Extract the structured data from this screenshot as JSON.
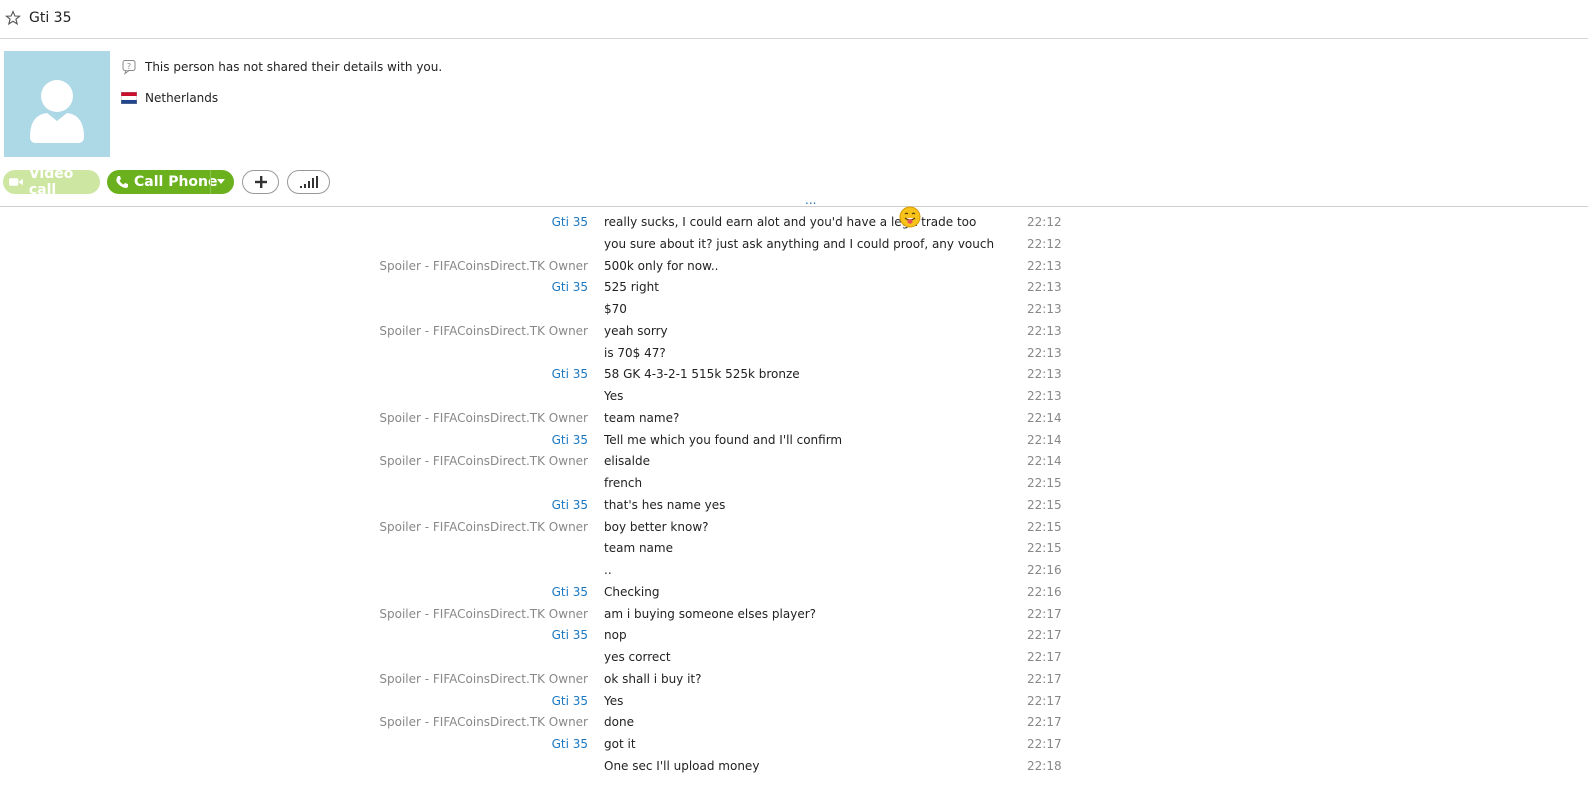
{
  "header": {
    "title": "Gti 35"
  },
  "profile": {
    "privacy_text": "This person has not shared their details with you.",
    "country": "Netherlands"
  },
  "actions": {
    "video_label": "Video call",
    "call_label": "Call Phone"
  },
  "more_messages": "...",
  "colors": {
    "accent_blue": "#1a78c2",
    "call_green": "#6ab11d",
    "avatar_bg": "#add8e6"
  },
  "messages": [
    {
      "sender": "Gti 35",
      "text": "really sucks, I could earn alot and you'd have a legit trade too",
      "time": "22:12"
    },
    {
      "sender": "",
      "text": "you sure about it? just ask anything and I could proof, any vouch",
      "time": "22:12"
    },
    {
      "sender": "Spoiler - FIFACoinsDirect.TK Owner",
      "text": "500k only for now..",
      "time": "22:13"
    },
    {
      "sender": "Gti 35",
      "text": "525 right",
      "time": "22:13"
    },
    {
      "sender": "",
      "text": "$70",
      "time": "22:13"
    },
    {
      "sender": "Spoiler - FIFACoinsDirect.TK Owner",
      "text": "yeah sorry",
      "time": "22:13"
    },
    {
      "sender": "",
      "text": "is 70$ 47?",
      "time": "22:13"
    },
    {
      "sender": "Gti 35",
      "text": "58 GK 4-3-2-1 515k 525k bronze",
      "time": "22:13"
    },
    {
      "sender": "",
      "text": "Yes",
      "time": "22:13"
    },
    {
      "sender": "Spoiler - FIFACoinsDirect.TK Owner",
      "text": "team name?",
      "time": "22:14"
    },
    {
      "sender": "Gti 35",
      "text": "Tell me which you found and I'll confirm",
      "time": "22:14"
    },
    {
      "sender": "Spoiler - FIFACoinsDirect.TK Owner",
      "text": "elisalde",
      "time": "22:14"
    },
    {
      "sender": "",
      "text": "french",
      "time": "22:15"
    },
    {
      "sender": "Gti 35",
      "text": "that's hes name yes",
      "time": "22:15"
    },
    {
      "sender": "Spoiler - FIFACoinsDirect.TK Owner",
      "text": "boy better know?",
      "time": "22:15"
    },
    {
      "sender": "",
      "text": "team name",
      "time": "22:15"
    },
    {
      "sender": "",
      "text": "..",
      "time": "22:16"
    },
    {
      "sender": "Gti 35",
      "text": "Checking",
      "time": "22:16"
    },
    {
      "sender": "Spoiler - FIFACoinsDirect.TK Owner",
      "text": "am i buying someone elses player?",
      "time": "22:17"
    },
    {
      "sender": "Gti 35",
      "text": "nop",
      "time": "22:17"
    },
    {
      "sender": "",
      "text": "yes correct",
      "time": "22:17"
    },
    {
      "sender": "Spoiler - FIFACoinsDirect.TK Owner",
      "text": "ok shall i buy it?",
      "time": "22:17"
    },
    {
      "sender": "Gti 35",
      "text": "Yes",
      "time": "22:17"
    },
    {
      "sender": "Spoiler - FIFACoinsDirect.TK Owner",
      "text": "done",
      "time": "22:17"
    },
    {
      "sender": "Gti 35",
      "text": "got it",
      "time": "22:17"
    },
    {
      "sender": "",
      "text": "One sec I'll upload money",
      "time": "22:18"
    }
  ]
}
